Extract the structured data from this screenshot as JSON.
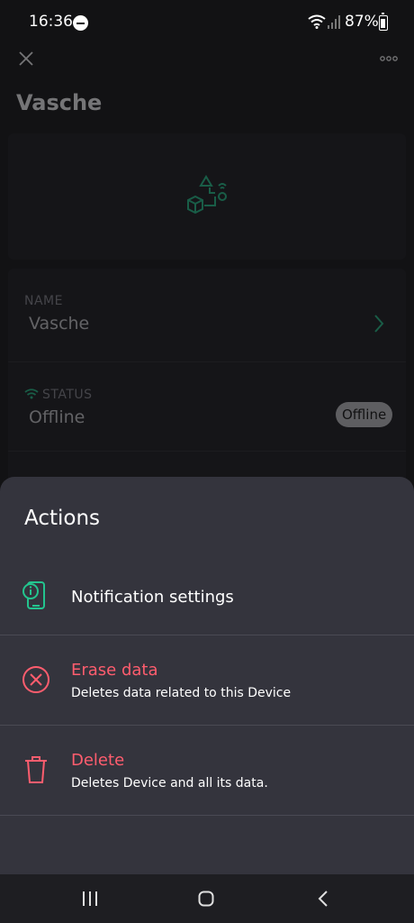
{
  "status_bar": {
    "time": "16:36",
    "battery_percent": "87%"
  },
  "header": {
    "title": "Vasche"
  },
  "device": {
    "name_label": "NAME",
    "name_value": "Vasche",
    "status_label": "STATUS",
    "status_value": "Offline",
    "status_badge": "Offline"
  },
  "sheet": {
    "title": "Actions",
    "actions": [
      {
        "title": "Notification settings",
        "subtitle": ""
      },
      {
        "title": "Erase data",
        "subtitle": "Deletes data related to this Device"
      },
      {
        "title": "Delete",
        "subtitle": "Deletes Device and all its data."
      }
    ]
  },
  "colors": {
    "accent_green": "#23c48e",
    "danger_red": "#ff5d6e",
    "sheet_bg": "#34343d"
  },
  "icons": {
    "close": "close-icon",
    "more": "more-icon",
    "notification": "phone-info-icon",
    "erase": "circle-x-icon",
    "delete": "trash-icon"
  }
}
